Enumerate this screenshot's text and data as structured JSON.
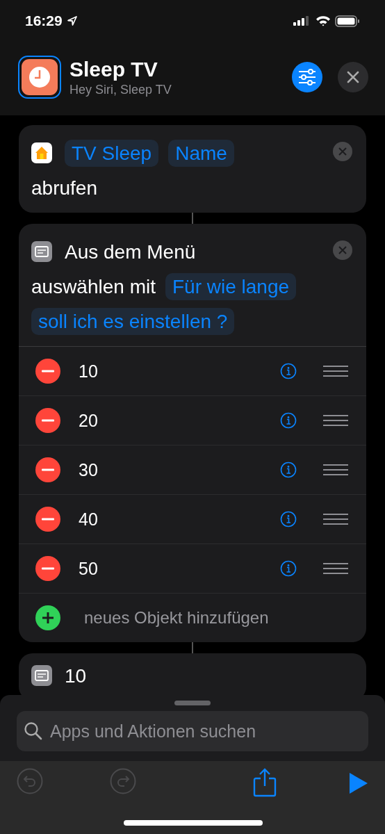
{
  "status_bar": {
    "time": "16:29"
  },
  "header": {
    "title": "Sleep TV",
    "subtitle": "Hey Siri, Sleep TV"
  },
  "actions": [
    {
      "kind": "home",
      "lines": [
        [
          {
            "kind": "token",
            "text": "TV Sleep"
          },
          {
            "kind": "token",
            "text": "Name"
          }
        ],
        [
          {
            "kind": "text",
            "text": "abrufen"
          }
        ]
      ]
    },
    {
      "kind": "menu",
      "lines": [
        [
          {
            "kind": "text",
            "text": "Aus dem Menü"
          }
        ],
        [
          {
            "kind": "text",
            "text": "auswählen mit"
          },
          {
            "kind": "token",
            "text": "Für wie lange"
          }
        ],
        [
          {
            "kind": "token",
            "text": "soll ich es einstellen ?"
          }
        ]
      ],
      "items": [
        {
          "label": "10"
        },
        {
          "label": "20"
        },
        {
          "label": "30"
        },
        {
          "label": "40"
        },
        {
          "label": "50"
        }
      ],
      "add_label": "neues Objekt hinzufügen"
    },
    {
      "kind": "menu",
      "lines": [
        [
          {
            "kind": "text",
            "text": "10"
          }
        ]
      ]
    }
  ],
  "search": {
    "placeholder": "Apps und Aktionen suchen"
  },
  "toolbar": [
    {
      "kind": "undo",
      "disabled": true
    },
    {
      "kind": "redo",
      "disabled": true
    },
    {
      "kind": "share",
      "disabled": false
    },
    {
      "kind": "run",
      "disabled": false
    }
  ]
}
